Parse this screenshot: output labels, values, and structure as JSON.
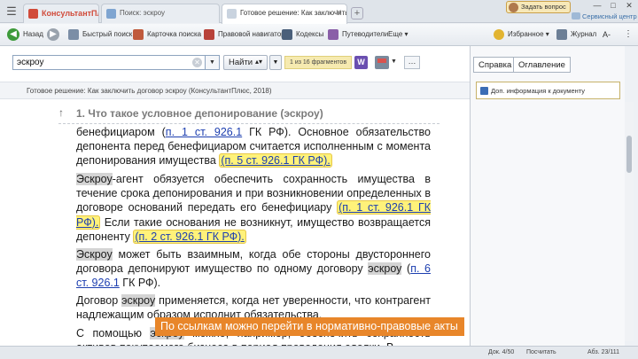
{
  "tabs": [
    {
      "label": "КонсультантПлюс"
    },
    {
      "label": "Поиск: эскроу"
    },
    {
      "label": "Готовое решение: Как заключить до..."
    }
  ],
  "top_right": {
    "ask_label": "Задать вопрос",
    "service_label": "Сервисный центр"
  },
  "toolbar": {
    "back": "Назад",
    "quick_search": "Быстрый поиск",
    "search_card": "Карточка поиска",
    "law_navigator": "Правовой навигатор",
    "codes": "Кодексы",
    "guides": "Путеводители",
    "more": "Еще",
    "favorites": "Избранное",
    "journal": "Журнал",
    "font_size": "A-"
  },
  "search": {
    "value": "эскроу",
    "find_label": "Найти",
    "fragment_count": "1 из 16 фрагментов"
  },
  "document": {
    "title": "Готовое решение: Как заключить договор эскроу (КонсультантПлюс, 2018)",
    "section_heading": "1. Что такое условное депонирование (эскроу)",
    "p1_a": "бенефициаром (",
    "p1_link1": "п. 1 ст. 926.1",
    "p1_b": " ГК РФ). Основное обязательство депонента перед бенефициаром считается исполненным с момента депонирования имущества ",
    "p1_link2": "(п. 5 ст. 926.1 ГК РФ).",
    "p2_term": "Эскроу",
    "p2_a": "-агент обязуется обеспечить сохранность имущества в течение срока депонирования и при возникновении определенных в договоре оснований передать его бенефициару ",
    "p2_link1": "(п. 1 ст. 926.1 ГК РФ).",
    "p2_b": " Если такие основания не возникнут, имущество возвращается депоненту ",
    "p2_link2": "(п. 2 ст. 926.1 ГК РФ).",
    "p3_term": "Эскроу",
    "p3_a": " может быть взаимным, когда обе стороны двустороннего договора депонируют имущество по одному договору ",
    "p3_term2": "эскроу",
    "p3_b": " (",
    "p3_link": "п. 6 ст. 926.1",
    "p3_c": " ГК РФ).",
    "p4_a": "Договор ",
    "p4_term": "эскроу",
    "p4_b": " применяется, когда нет уверенности, что контрагент надлежащим образом исполнит обязательства.",
    "p5_a": "С помощью ",
    "p5_term": "эскроу",
    "p5_b": " можно, например, обеспечить сохранность активов покупаемого бизнеса в период проведения сделки. В"
  },
  "right_panel": {
    "tab_help": "Справка",
    "tab_contents": "Оглавление",
    "info_link": "Доп. информация к документу"
  },
  "status": {
    "doc_counter": "Док. 4/50",
    "print_label": "Посчитать",
    "page_counter": "Абз. 23/111"
  },
  "caption": "По ссылкам можно перейти в нормативно-правовые акты",
  "colors": {
    "highlight": "#fff27a",
    "link": "#1d3fb0",
    "caption_bg": "#e8862a"
  }
}
